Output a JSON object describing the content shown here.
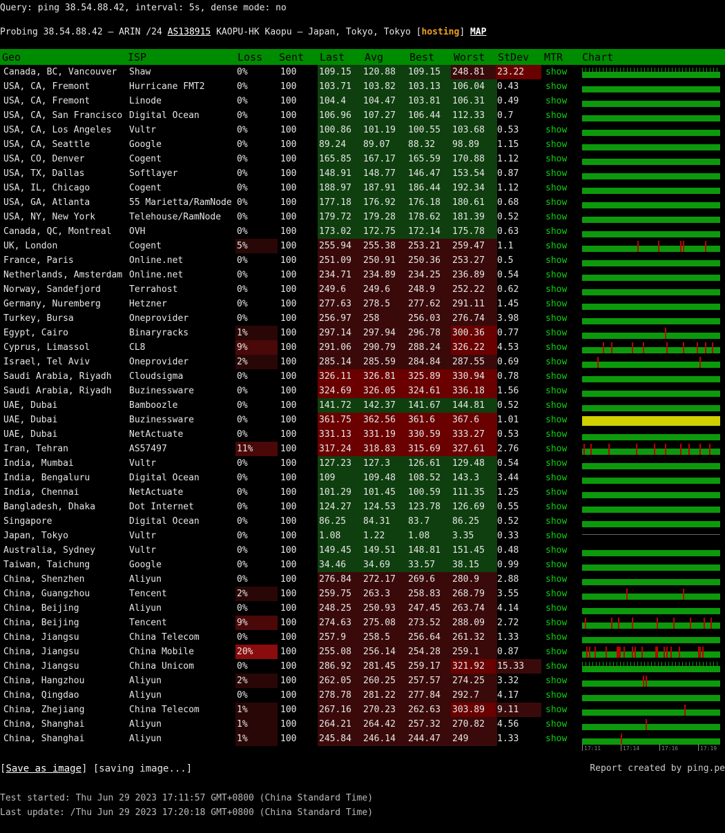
{
  "query_line": "Query: ping 38.54.88.42, interval: 5s, dense mode: no",
  "probe": {
    "prefix": "Probing 38.54.88.42 – ARIN /24 ",
    "asn": "AS138915",
    "middle": " KAOPU-HK Kaopu – Japan, Tokyo, Tokyo [",
    "tag": "hosting",
    "close": "] ",
    "map": "MAP"
  },
  "headers": [
    "Geo",
    "ISP",
    "Loss",
    "Sent",
    "Last",
    "Avg",
    "Best",
    "Worst",
    "StDev",
    "MTR",
    "Chart"
  ],
  "mtr_label": "show",
  "colors": {
    "header_bg": "#008c00",
    "chart_ok": "#0c9a0c",
    "chart_loss": "#c00000",
    "chart_warn": "#d0d000",
    "lat_good": "#0f3f0f",
    "lat_mid": "#3a0a0a",
    "lat_bad": "#6a0000",
    "loss_low": "#2a0707",
    "loss_mid": "#4a0808",
    "loss_high": "#8a0c0c"
  },
  "rows": [
    {
      "geo": "Canada, BC, Vancouver",
      "isp": "Shaw",
      "loss": "0%",
      "sent": "100",
      "last": "109.15",
      "avg": "120.88",
      "best": "109.15",
      "worst": "248.81",
      "stdev": "23.22",
      "chart": "gappy",
      "marks": []
    },
    {
      "geo": "USA, CA, Fremont",
      "isp": "Hurricane FMT2",
      "loss": "0%",
      "sent": "100",
      "last": "103.71",
      "avg": "103.82",
      "best": "103.13",
      "worst": "106.04",
      "stdev": "0.43",
      "chart": "ok",
      "marks": []
    },
    {
      "geo": "USA, CA, Fremont",
      "isp": "Linode",
      "loss": "0%",
      "sent": "100",
      "last": "104.4",
      "avg": "104.47",
      "best": "103.81",
      "worst": "106.31",
      "stdev": "0.49",
      "chart": "ok",
      "marks": []
    },
    {
      "geo": "USA, CA, San Francisco",
      "isp": "Digital Ocean",
      "loss": "0%",
      "sent": "100",
      "last": "106.96",
      "avg": "107.27",
      "best": "106.44",
      "worst": "112.33",
      "stdev": "0.7",
      "chart": "ok",
      "marks": []
    },
    {
      "geo": "USA, CA, Los Angeles",
      "isp": "Vultr",
      "loss": "0%",
      "sent": "100",
      "last": "100.86",
      "avg": "101.19",
      "best": "100.55",
      "worst": "103.68",
      "stdev": "0.53",
      "chart": "ok",
      "marks": []
    },
    {
      "geo": "USA, CA, Seattle",
      "isp": "Google",
      "loss": "0%",
      "sent": "100",
      "last": "89.24",
      "avg": "89.07",
      "best": "88.32",
      "worst": "98.89",
      "stdev": "1.15",
      "chart": "ok",
      "marks": []
    },
    {
      "geo": "USA, CO, Denver",
      "isp": "Cogent",
      "loss": "0%",
      "sent": "100",
      "last": "165.85",
      "avg": "167.17",
      "best": "165.59",
      "worst": "170.88",
      "stdev": "1.12",
      "chart": "ok",
      "marks": []
    },
    {
      "geo": "USA, TX, Dallas",
      "isp": "Softlayer",
      "loss": "0%",
      "sent": "100",
      "last": "148.91",
      "avg": "148.77",
      "best": "146.47",
      "worst": "153.54",
      "stdev": "0.87",
      "chart": "ok",
      "marks": []
    },
    {
      "geo": "USA, IL, Chicago",
      "isp": "Cogent",
      "loss": "0%",
      "sent": "100",
      "last": "188.97",
      "avg": "187.91",
      "best": "186.44",
      "worst": "192.34",
      "stdev": "1.12",
      "chart": "ok",
      "marks": []
    },
    {
      "geo": "USA, GA, Atlanta",
      "isp": "55 Marietta/RamNode",
      "loss": "0%",
      "sent": "100",
      "last": "177.18",
      "avg": "176.92",
      "best": "176.18",
      "worst": "180.61",
      "stdev": "0.68",
      "chart": "ok",
      "marks": []
    },
    {
      "geo": "USA, NY, New York",
      "isp": "Telehouse/RamNode",
      "loss": "0%",
      "sent": "100",
      "last": "179.72",
      "avg": "179.28",
      "best": "178.62",
      "worst": "181.39",
      "stdev": "0.52",
      "chart": "ok",
      "marks": []
    },
    {
      "geo": "Canada, QC, Montreal",
      "isp": "OVH",
      "loss": "0%",
      "sent": "100",
      "last": "173.02",
      "avg": "172.75",
      "best": "172.14",
      "worst": "175.78",
      "stdev": "0.63",
      "chart": "ok",
      "marks": []
    },
    {
      "geo": "UK, London",
      "isp": "Cogent",
      "loss": "5%",
      "sent": "100",
      "last": "255.94",
      "avg": "255.38",
      "best": "253.21",
      "worst": "259.47",
      "stdev": "1.1",
      "chart": "ok",
      "marks": [
        40,
        55,
        71,
        73,
        89
      ]
    },
    {
      "geo": "France, Paris",
      "isp": "Online.net",
      "loss": "0%",
      "sent": "100",
      "last": "251.09",
      "avg": "250.91",
      "best": "250.36",
      "worst": "253.27",
      "stdev": "0.5",
      "chart": "ok",
      "marks": []
    },
    {
      "geo": "Netherlands, Amsterdam",
      "isp": "Online.net",
      "loss": "0%",
      "sent": "100",
      "last": "234.71",
      "avg": "234.89",
      "best": "234.25",
      "worst": "236.89",
      "stdev": "0.54",
      "chart": "ok",
      "marks": []
    },
    {
      "geo": "Norway, Sandefjord",
      "isp": "Terrahost",
      "loss": "0%",
      "sent": "100",
      "last": "249.6",
      "avg": "249.6",
      "best": "248.9",
      "worst": "252.22",
      "stdev": "0.62",
      "chart": "ok",
      "marks": []
    },
    {
      "geo": "Germany, Nuremberg",
      "isp": "Hetzner",
      "loss": "0%",
      "sent": "100",
      "last": "277.63",
      "avg": "278.5",
      "best": "277.62",
      "worst": "291.11",
      "stdev": "1.45",
      "chart": "ok",
      "marks": []
    },
    {
      "geo": "Turkey, Bursa",
      "isp": "Oneprovider",
      "loss": "0%",
      "sent": "100",
      "last": "256.97",
      "avg": "258",
      "best": "256.03",
      "worst": "276.74",
      "stdev": "3.98",
      "chart": "ok",
      "marks": []
    },
    {
      "geo": "Egypt, Cairo",
      "isp": "Binaryracks",
      "loss": "1%",
      "sent": "100",
      "last": "297.14",
      "avg": "297.94",
      "best": "296.78",
      "worst": "300.36",
      "stdev": "0.77",
      "chart": "ok",
      "marks": [
        60
      ]
    },
    {
      "geo": "Cyprus, Limassol",
      "isp": "CL8",
      "loss": "9%",
      "sent": "100",
      "last": "291.06",
      "avg": "290.79",
      "best": "288.24",
      "worst": "326.22",
      "stdev": "4.53",
      "chart": "ok",
      "marks": [
        15,
        21,
        36,
        44,
        61,
        73,
        83,
        89,
        94
      ]
    },
    {
      "geo": "Israel, Tel Aviv",
      "isp": "Oneprovider",
      "loss": "2%",
      "sent": "100",
      "last": "285.14",
      "avg": "285.59",
      "best": "284.84",
      "worst": "287.55",
      "stdev": "0.69",
      "chart": "ok",
      "marks": [
        11,
        85
      ]
    },
    {
      "geo": "Saudi Arabia, Riyadh",
      "isp": "Cloudsigma",
      "loss": "0%",
      "sent": "100",
      "last": "326.11",
      "avg": "326.81",
      "best": "325.89",
      "worst": "330.94",
      "stdev": "0.78",
      "chart": "ok",
      "marks": []
    },
    {
      "geo": "Saudi Arabia, Riyadh",
      "isp": "Buzinessware",
      "loss": "0%",
      "sent": "100",
      "last": "324.69",
      "avg": "326.05",
      "best": "324.61",
      "worst": "336.18",
      "stdev": "1.56",
      "chart": "ok",
      "marks": []
    },
    {
      "geo": "UAE, Dubai",
      "isp": "Bamboozle",
      "loss": "0%",
      "sent": "100",
      "last": "141.72",
      "avg": "142.37",
      "best": "141.67",
      "worst": "144.81",
      "stdev": "0.52",
      "chart": "ok",
      "marks": []
    },
    {
      "geo": "UAE, Dubai",
      "isp": "Buzinessware",
      "loss": "0%",
      "sent": "100",
      "last": "361.75",
      "avg": "362.56",
      "best": "361.6",
      "worst": "367.6",
      "stdev": "1.01",
      "chart": "warn",
      "marks": []
    },
    {
      "geo": "UAE, Dubai",
      "isp": "NetActuate",
      "loss": "0%",
      "sent": "100",
      "last": "331.13",
      "avg": "331.19",
      "best": "330.59",
      "worst": "333.27",
      "stdev": "0.53",
      "chart": "ok",
      "marks": []
    },
    {
      "geo": "Iran, Tehran",
      "isp": "AS57497",
      "loss": "11%",
      "sent": "100",
      "last": "317.24",
      "avg": "318.83",
      "best": "315.69",
      "worst": "327.61",
      "stdev": "2.76",
      "chart": "ok",
      "marks": [
        1,
        6,
        19,
        39,
        52,
        60,
        71,
        77,
        85,
        92
      ]
    },
    {
      "geo": "India, Mumbai",
      "isp": "Vultr",
      "loss": "0%",
      "sent": "100",
      "last": "127.23",
      "avg": "127.3",
      "best": "126.61",
      "worst": "129.48",
      "stdev": "0.54",
      "chart": "ok",
      "marks": []
    },
    {
      "geo": "India, Bengaluru",
      "isp": "Digital Ocean",
      "loss": "0%",
      "sent": "100",
      "last": "109",
      "avg": "109.48",
      "best": "108.52",
      "worst": "143.3",
      "stdev": "3.44",
      "chart": "ok",
      "marks": []
    },
    {
      "geo": "India, Chennai",
      "isp": "NetActuate",
      "loss": "0%",
      "sent": "100",
      "last": "101.29",
      "avg": "101.45",
      "best": "100.59",
      "worst": "111.35",
      "stdev": "1.25",
      "chart": "ok",
      "marks": []
    },
    {
      "geo": "Bangladesh, Dhaka",
      "isp": "Dot Internet",
      "loss": "0%",
      "sent": "100",
      "last": "124.27",
      "avg": "124.53",
      "best": "123.78",
      "worst": "126.69",
      "stdev": "0.55",
      "chart": "ok",
      "marks": []
    },
    {
      "geo": "Singapore",
      "isp": "Digital Ocean",
      "loss": "0%",
      "sent": "100",
      "last": "86.25",
      "avg": "84.31",
      "best": "83.7",
      "worst": "86.25",
      "stdev": "0.52",
      "chart": "ok",
      "marks": []
    },
    {
      "geo": "Japan, Tokyo",
      "isp": "Vultr",
      "loss": "0%",
      "sent": "100",
      "last": "1.08",
      "avg": "1.22",
      "best": "1.08",
      "worst": "3.35",
      "stdev": "0.33",
      "chart": "thin",
      "marks": []
    },
    {
      "geo": "Australia, Sydney",
      "isp": "Vultr",
      "loss": "0%",
      "sent": "100",
      "last": "149.45",
      "avg": "149.51",
      "best": "148.81",
      "worst": "151.45",
      "stdev": "0.48",
      "chart": "ok",
      "marks": []
    },
    {
      "geo": "Taiwan, Taichung",
      "isp": "Google",
      "loss": "0%",
      "sent": "100",
      "last": "34.46",
      "avg": "34.69",
      "best": "33.57",
      "worst": "38.15",
      "stdev": "0.99",
      "chart": "ok",
      "marks": []
    },
    {
      "geo": "China, Shenzhen",
      "isp": "Aliyun",
      "loss": "0%",
      "sent": "100",
      "last": "276.84",
      "avg": "272.17",
      "best": "269.6",
      "worst": "280.9",
      "stdev": "2.88",
      "chart": "ok",
      "marks": []
    },
    {
      "geo": "China, Guangzhou",
      "isp": "Tencent",
      "loss": "2%",
      "sent": "100",
      "last": "259.75",
      "avg": "263.3",
      "best": "258.83",
      "worst": "268.79",
      "stdev": "3.55",
      "chart": "ok",
      "marks": [
        32,
        73
      ]
    },
    {
      "geo": "China, Beijing",
      "isp": "Aliyun",
      "loss": "0%",
      "sent": "100",
      "last": "248.25",
      "avg": "250.93",
      "best": "247.45",
      "worst": "263.74",
      "stdev": "4.14",
      "chart": "ok",
      "marks": []
    },
    {
      "geo": "China, Beijing",
      "isp": "Tencent",
      "loss": "9%",
      "sent": "100",
      "last": "274.63",
      "avg": "275.08",
      "best": "273.52",
      "worst": "288.09",
      "stdev": "2.72",
      "chart": "ok",
      "marks": [
        2,
        21,
        26,
        36,
        54,
        66,
        78,
        88,
        93
      ]
    },
    {
      "geo": "China, Jiangsu",
      "isp": "China Telecom",
      "loss": "0%",
      "sent": "100",
      "last": "257.9",
      "avg": "258.5",
      "best": "256.64",
      "worst": "261.32",
      "stdev": "1.33",
      "chart": "ok",
      "marks": []
    },
    {
      "geo": "China, Jiangsu",
      "isp": "China Mobile",
      "loss": "20%",
      "sent": "100",
      "last": "255.08",
      "avg": "256.14",
      "best": "254.28",
      "worst": "259.1",
      "stdev": "0.87",
      "chart": "ok",
      "marks": [
        3,
        5,
        9,
        17,
        25,
        26,
        27,
        30,
        36,
        38,
        43,
        53,
        54,
        59,
        61,
        64,
        70,
        84,
        85,
        87
      ]
    },
    {
      "geo": "China, Jiangsu",
      "isp": "China Unicom",
      "loss": "0%",
      "sent": "100",
      "last": "286.92",
      "avg": "281.45",
      "best": "259.17",
      "worst": "321.92",
      "stdev": "15.33",
      "chart": "gappy",
      "marks": []
    },
    {
      "geo": "China, Hangzhou",
      "isp": "Aliyun",
      "loss": "2%",
      "sent": "100",
      "last": "262.05",
      "avg": "260.25",
      "best": "257.57",
      "worst": "274.25",
      "stdev": "3.32",
      "chart": "ok",
      "marks": [
        44,
        46
      ]
    },
    {
      "geo": "China, Qingdao",
      "isp": "Aliyun",
      "loss": "0%",
      "sent": "100",
      "last": "278.78",
      "avg": "281.22",
      "best": "277.84",
      "worst": "292.7",
      "stdev": "4.17",
      "chart": "ok",
      "marks": []
    },
    {
      "geo": "China, Zhejiang",
      "isp": "China Telecom",
      "loss": "1%",
      "sent": "100",
      "last": "267.16",
      "avg": "270.23",
      "best": "262.63",
      "worst": "303.89",
      "stdev": "9.11",
      "chart": "ok",
      "marks": [
        74
      ]
    },
    {
      "geo": "China, Shanghai",
      "isp": "Aliyun",
      "loss": "1%",
      "sent": "100",
      "last": "264.21",
      "avg": "264.42",
      "best": "257.32",
      "worst": "270.82",
      "stdev": "4.56",
      "chart": "ok",
      "marks": [
        46
      ]
    },
    {
      "geo": "China, Shanghai",
      "isp": "Aliyun",
      "loss": "1%",
      "sent": "100",
      "last": "245.84",
      "avg": "246.14",
      "best": "244.47",
      "worst": "249",
      "stdev": "1.33",
      "chart": "ok",
      "marks": [
        28
      ]
    }
  ],
  "axis_ticks": [
    "17:11",
    "17:14",
    "17:16",
    "17:19"
  ],
  "footer": {
    "save_open": "[",
    "save_label": "Save as image",
    "save_close": "] [saving image...]",
    "credit": "Report created by ping.pe",
    "started": "Test started: Thu Jun 29 2023 17:11:57 GMT+0800 (China Standard Time)",
    "updated": "Last update: /Thu Jun 29 2023 17:20:18 GMT+0800 (China Standard Time)"
  }
}
